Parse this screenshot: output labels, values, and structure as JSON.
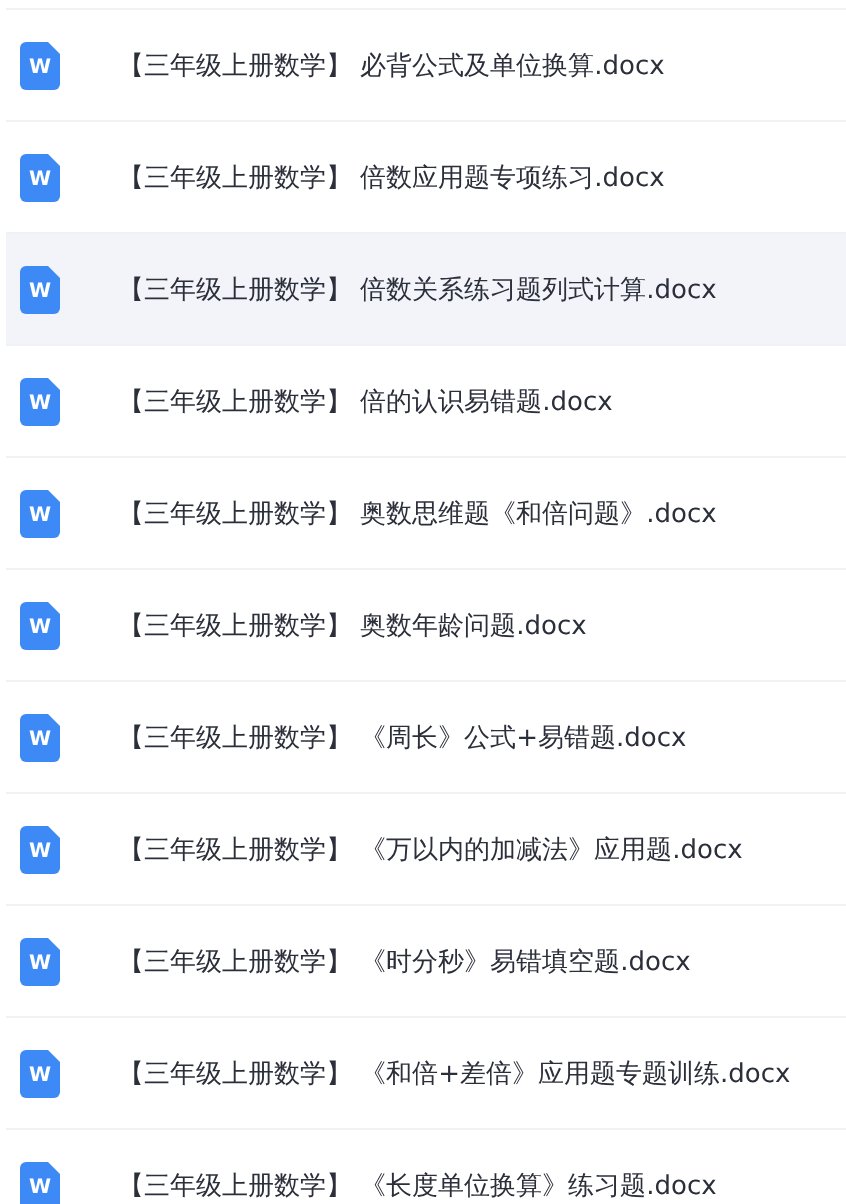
{
  "files": [
    {
      "name": "【三年级上册数学】 必背公式及单位换算.docx",
      "icon_letter": "W",
      "selected": false
    },
    {
      "name": "【三年级上册数学】 倍数应用题专项练习.docx",
      "icon_letter": "W",
      "selected": false
    },
    {
      "name": "【三年级上册数学】 倍数关系练习题列式计算.docx",
      "icon_letter": "W",
      "selected": true
    },
    {
      "name": "【三年级上册数学】 倍的认识易错题.docx",
      "icon_letter": "W",
      "selected": false
    },
    {
      "name": "【三年级上册数学】 奥数思维题《和倍问题》.docx",
      "icon_letter": "W",
      "selected": false
    },
    {
      "name": "【三年级上册数学】 奥数年龄问题.docx",
      "icon_letter": "W",
      "selected": false
    },
    {
      "name": "【三年级上册数学】 《周长》公式+易错题.docx",
      "icon_letter": "W",
      "selected": false
    },
    {
      "name": "【三年级上册数学】 《万以内的加减法》应用题.docx",
      "icon_letter": "W",
      "selected": false
    },
    {
      "name": "【三年级上册数学】 《时分秒》易错填空题.docx",
      "icon_letter": "W",
      "selected": false
    },
    {
      "name": "【三年级上册数学】 《和倍+差倍》应用题专题训练.docx",
      "icon_letter": "W",
      "selected": false
    },
    {
      "name": "【三年级上册数学】 《长度单位换算》练习题.docx",
      "icon_letter": "W",
      "selected": false
    }
  ]
}
